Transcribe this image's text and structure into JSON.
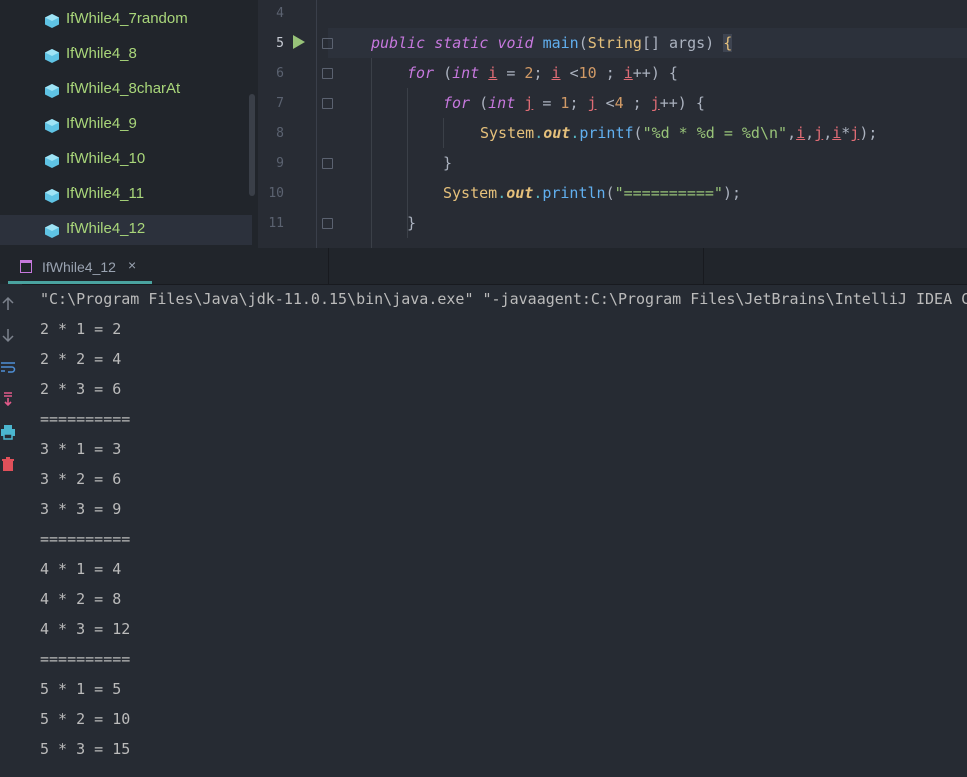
{
  "project_tree": {
    "items": [
      {
        "label": "IfWhile4_7random",
        "selected": false
      },
      {
        "label": "IfWhile4_8",
        "selected": false
      },
      {
        "label": "IfWhile4_8charAt",
        "selected": false
      },
      {
        "label": "IfWhile4_9",
        "selected": false
      },
      {
        "label": "IfWhile4_10",
        "selected": false
      },
      {
        "label": "IfWhile4_11",
        "selected": false
      },
      {
        "label": "IfWhile4_12",
        "selected": true
      }
    ],
    "icon": "java-class-icon"
  },
  "editor": {
    "line_numbers": [
      "4",
      "5",
      "6",
      "7",
      "8",
      "9",
      "10",
      "11"
    ],
    "current_line": "5",
    "code": {
      "l5": {
        "kw1": "public",
        "kw2": "static",
        "kw3": "void",
        "name": "main",
        "type": "String",
        "rest": "[] args)",
        "brace": "{"
      },
      "l6": {
        "kw": "for",
        "p1": "(",
        "kwint": "int",
        "v": "i",
        "eq": "=",
        "n1": "2",
        "sc1": ";",
        "v2": "i",
        "lt": "<",
        "n2": "10",
        "sc2": ";",
        "v3": "i",
        "inc": "++) {"
      },
      "l7": {
        "kw": "for",
        "p1": "(",
        "kwint": "int",
        "v": "j",
        "eq": "=",
        "n1": "1",
        "sc1": ";",
        "v2": "j",
        "lt": "<",
        "n2": "4",
        "sc2": ";",
        "v3": "j",
        "inc": "++) {"
      },
      "l8": {
        "cls": "System",
        "dot1": ".",
        "fld": "out",
        "dot2": ".",
        "mth": "printf",
        "p1": "(",
        "str": "\"%d * %d = %d\\n\"",
        "c1": ",",
        "a1": "i",
        "c2": ",",
        "a2": "j",
        "c3": ",",
        "a3": "i",
        "op": "*",
        "a4": "j",
        "end": ");"
      },
      "l9": "}",
      "l10": {
        "cls": "System",
        "dot1": ".",
        "fld": "out",
        "dot2": ".",
        "mth": "println",
        "p1": "(",
        "str": "\"==========\"",
        "end": ");"
      },
      "l11": "}"
    }
  },
  "run_panel": {
    "tab_label": "IfWhile4_12",
    "tab_close": "×",
    "tab_icon": "run-console-icon",
    "toolbar_icons": [
      "up-arrow-icon",
      "down-arrow-icon",
      "soft-wrap-icon",
      "scroll-to-end-icon",
      "print-icon",
      "trash-icon"
    ],
    "output": [
      "\"C:\\Program Files\\Java\\jdk-11.0.15\\bin\\java.exe\" \"-javaagent:C:\\Program Files\\JetBrains\\IntelliJ IDEA C",
      "2 * 1 = 2",
      "2 * 2 = 4",
      "2 * 3 = 6",
      "==========",
      "3 * 1 = 3",
      "3 * 2 = 6",
      "3 * 3 = 9",
      "==========",
      "4 * 1 = 4",
      "4 * 2 = 8",
      "4 * 3 = 12",
      "==========",
      "5 * 1 = 5",
      "5 * 2 = 10",
      "5 * 3 = 15"
    ]
  },
  "colors": {
    "tree_text": "#a9d67a",
    "keyword": "#c678dd",
    "string": "#98c379",
    "number": "#d19a66",
    "tab_underline": "#4aa3a0",
    "run_icon": "#98c379"
  }
}
